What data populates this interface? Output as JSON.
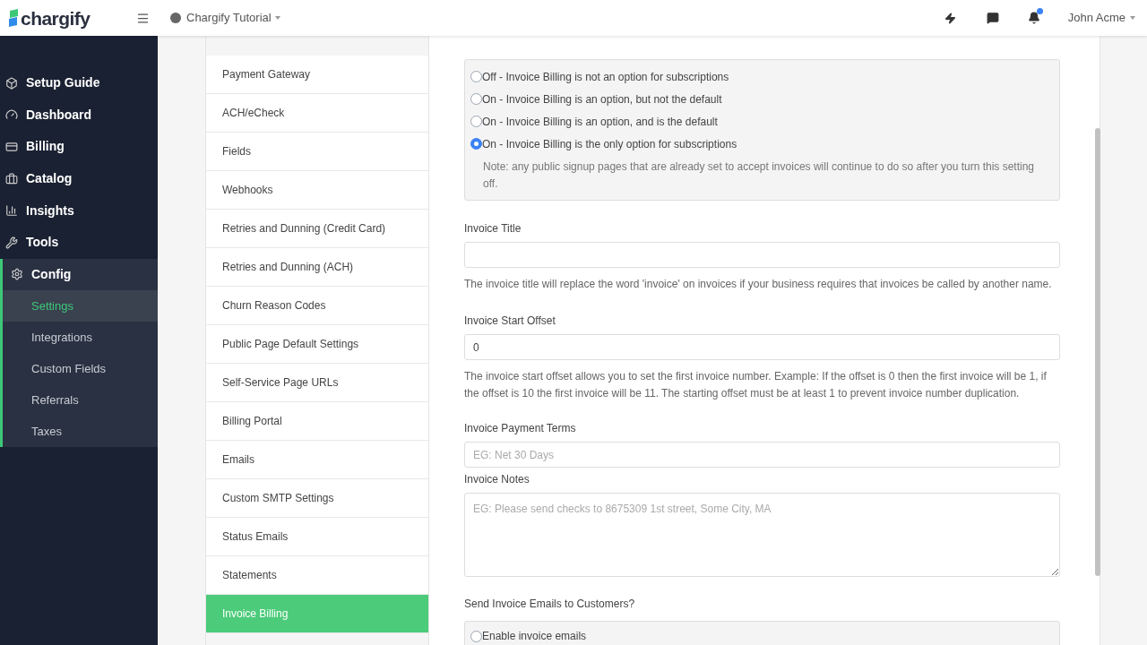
{
  "topbar": {
    "brand": "chargify",
    "site": "Chargify Tutorial",
    "user": "John Acme",
    "notification_badge": true
  },
  "sidebar": {
    "items": [
      {
        "label": "Setup Guide",
        "selected": false
      },
      {
        "label": "Dashboard",
        "selected": false
      },
      {
        "label": "Billing",
        "selected": false
      },
      {
        "label": "Catalog",
        "selected": false
      },
      {
        "label": "Insights",
        "selected": false
      },
      {
        "label": "Tools",
        "selected": false
      },
      {
        "label": "Config",
        "selected": true,
        "children": [
          {
            "label": "Settings",
            "selected": true
          },
          {
            "label": "Integrations",
            "selected": false
          },
          {
            "label": "Custom Fields",
            "selected": false
          },
          {
            "label": "Referrals",
            "selected": false
          },
          {
            "label": "Taxes",
            "selected": false
          }
        ]
      }
    ]
  },
  "settings_nav": [
    {
      "label": "Payment Gateway",
      "selected": false
    },
    {
      "label": "ACH/eCheck",
      "selected": false
    },
    {
      "label": "Fields",
      "selected": false
    },
    {
      "label": "Webhooks",
      "selected": false
    },
    {
      "label": "Retries and Dunning (Credit Card)",
      "selected": false
    },
    {
      "label": "Retries and Dunning (ACH)",
      "selected": false
    },
    {
      "label": "Churn Reason Codes",
      "selected": false
    },
    {
      "label": "Public Page Default Settings",
      "selected": false
    },
    {
      "label": "Self-Service Page URLs",
      "selected": false
    },
    {
      "label": "Billing Portal",
      "selected": false
    },
    {
      "label": "Emails",
      "selected": false
    },
    {
      "label": "Custom SMTP Settings",
      "selected": false
    },
    {
      "label": "Status Emails",
      "selected": false
    },
    {
      "label": "Statements",
      "selected": false
    },
    {
      "label": "Invoice Billing",
      "selected": true
    }
  ],
  "invoice_billing": {
    "options": [
      {
        "label": "Off - Invoice Billing is not an option for subscriptions",
        "selected": false
      },
      {
        "label": "On - Invoice Billing is an option, but not the default",
        "selected": false
      },
      {
        "label": "On - Invoice Billing is an option, and is the default",
        "selected": false
      },
      {
        "label": "On - Invoice Billing is the only option for subscriptions",
        "selected": true
      }
    ],
    "note": "Note: any public signup pages that are already set to accept invoices will continue to do so after you turn this setting off."
  },
  "fields": [
    {
      "kind": "input",
      "label": "Invoice Title",
      "help": "The invoice title will replace the word 'invoice' on invoices if your business requires that invoices be called by another name."
    },
    {
      "kind": "input",
      "label": "Invoice Start Offset",
      "value": "0",
      "help": "The invoice start offset allows you to set the first invoice number. Example: If the offset is 0 then the first invoice will be 1, if the offset is 10 the first invoice will be 11. The starting offset must be at least 1 to prevent invoice number duplication."
    },
    {
      "kind": "input",
      "label": "Invoice Payment Terms",
      "placeholder": "EG: Net 30 Days"
    },
    {
      "kind": "textarea",
      "label": "Invoice Notes",
      "placeholder": "EG: Please send checks to 8675309 1st street, Some City, MA"
    }
  ],
  "invoice_emails": {
    "label": "Send Invoice Emails to Customers?",
    "options": [
      {
        "label": "Enable invoice emails",
        "selected": false
      }
    ]
  }
}
